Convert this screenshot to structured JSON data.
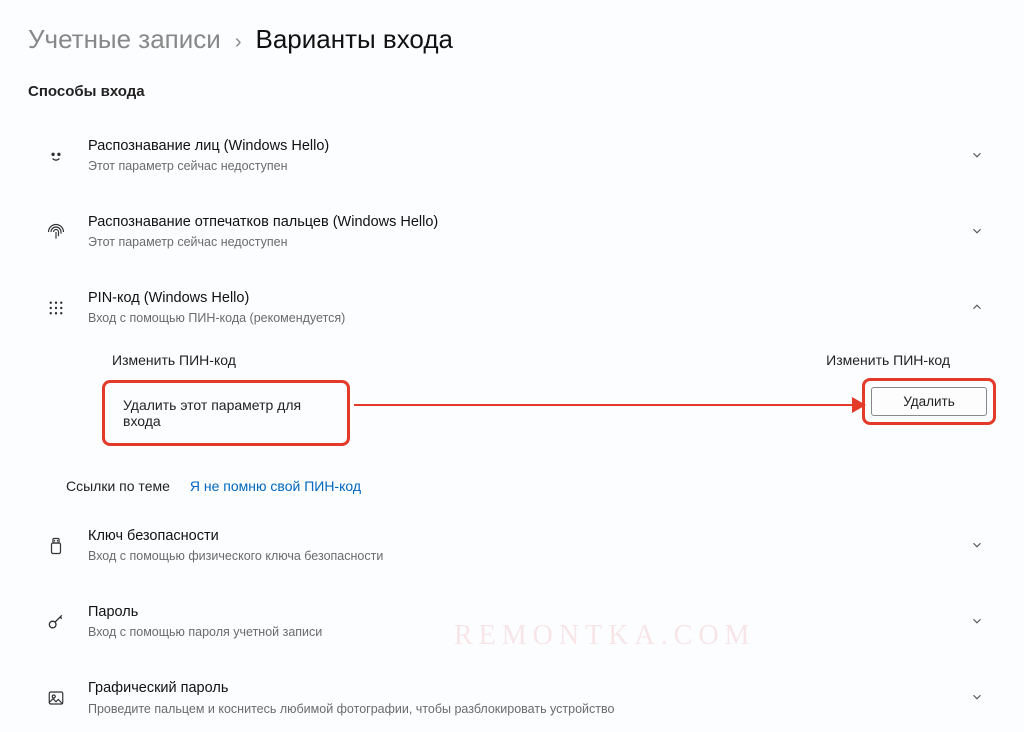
{
  "breadcrumb": {
    "parent": "Учетные записи",
    "sep": "›",
    "current": "Варианты входа"
  },
  "section": {
    "title": "Способы входа"
  },
  "options": {
    "face": {
      "title": "Распознавание лиц (Windows Hello)",
      "subtitle": "Этот параметр сейчас недоступен"
    },
    "finger": {
      "title": "Распознавание отпечатков пальцев (Windows Hello)",
      "subtitle": "Этот параметр сейчас недоступен"
    },
    "pin": {
      "title": "PIN-код (Windows Hello)",
      "subtitle": "Вход с помощью ПИН-кода (рекомендуется)"
    },
    "key": {
      "title": "Ключ безопасности",
      "subtitle": "Вход с помощью физического ключа безопасности"
    },
    "pass": {
      "title": "Пароль",
      "subtitle": "Вход с помощью пароля учетной записи"
    },
    "pic": {
      "title": "Графический пароль",
      "subtitle": "Проведите пальцем и коснитесь любимой фотографии, чтобы разблокировать устройство"
    }
  },
  "pin_expanded": {
    "change_left": "Изменить ПИН-код",
    "change_right": "Изменить ПИН-код",
    "remove_label": "Удалить этот параметр для входа",
    "remove_button": "Удалить"
  },
  "related": {
    "label": "Ссылки по теме",
    "link": "Я не помню свой ПИН-код"
  },
  "watermark": "REMONTKA.COM"
}
